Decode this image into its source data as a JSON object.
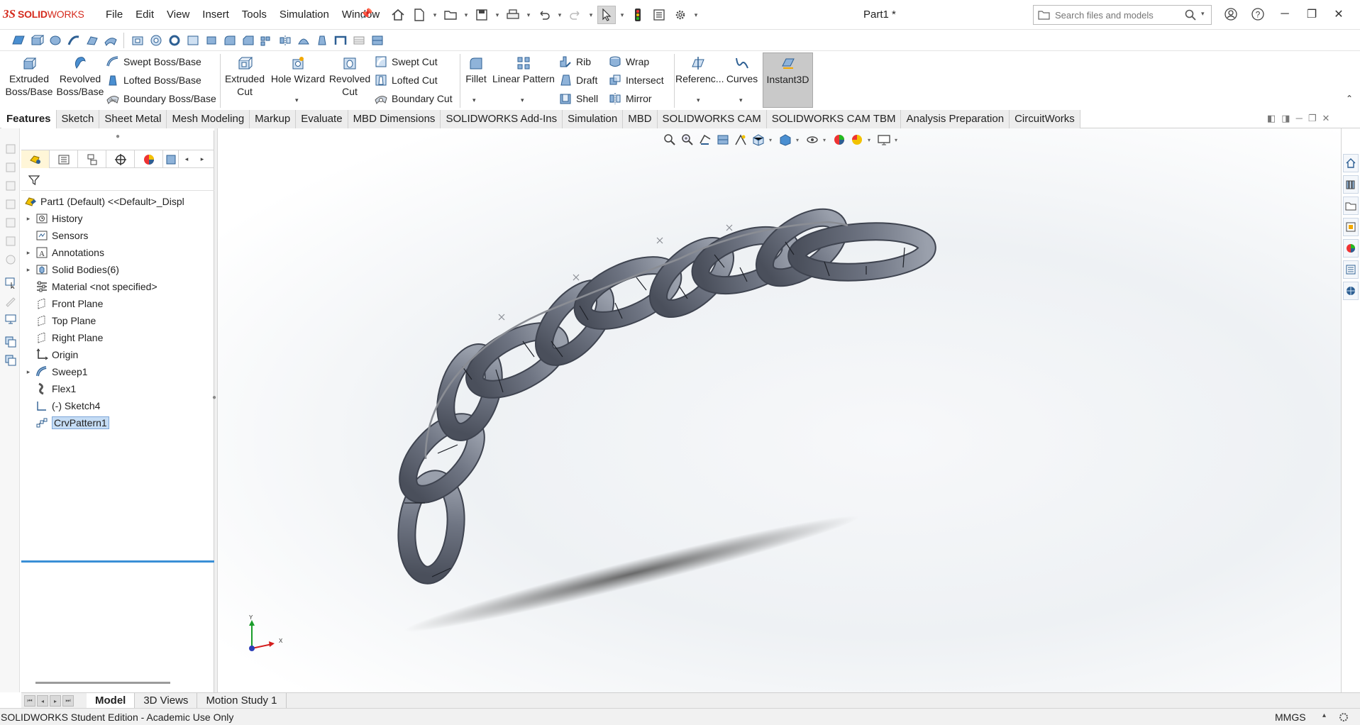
{
  "app": {
    "brand_ds": "3S",
    "brand_name": "SOLID",
    "brand_name2": "WORKS",
    "document_title": "Part1 *"
  },
  "menu": [
    "File",
    "Edit",
    "View",
    "Insert",
    "Tools",
    "Simulation",
    "Window"
  ],
  "search": {
    "placeholder": "Search files and models"
  },
  "command_manager": {
    "extruded_boss": "Extruded Boss/Base",
    "revolved_boss": "Revolved Boss/Base",
    "swept_boss": "Swept Boss/Base",
    "lofted_boss": "Lofted Boss/Base",
    "boundary_boss": "Boundary Boss/Base",
    "extruded_cut": "Extruded Cut",
    "hole_wizard": "Hole Wizard",
    "revolved_cut": "Revolved Cut",
    "swept_cut": "Swept Cut",
    "lofted_cut": "Lofted Cut",
    "boundary_cut": "Boundary Cut",
    "fillet": "Fillet",
    "linear_pattern": "Linear Pattern",
    "rib": "Rib",
    "draft": "Draft",
    "shell": "Shell",
    "wrap": "Wrap",
    "intersect": "Intersect",
    "mirror": "Mirror",
    "reference": "Referenc...",
    "curves": "Curves",
    "instant3d": "Instant3D"
  },
  "tabs": [
    "Features",
    "Sketch",
    "Sheet Metal",
    "Mesh Modeling",
    "Markup",
    "Evaluate",
    "MBD Dimensions",
    "SOLIDWORKS Add-Ins",
    "Simulation",
    "MBD",
    "SOLIDWORKS CAM",
    "SOLIDWORKS CAM TBM",
    "Analysis Preparation",
    "CircuitWorks"
  ],
  "tree": [
    {
      "label": "Part1 (Default) <<Default>_Displ",
      "expand": "",
      "icon": "part-icon"
    },
    {
      "label": "History",
      "expand": "▸",
      "icon": "history-icon"
    },
    {
      "label": "Sensors",
      "expand": "",
      "icon": "sensors-icon"
    },
    {
      "label": "Annotations",
      "expand": "▸",
      "icon": "annotations-icon"
    },
    {
      "label": "Solid Bodies(6)",
      "expand": "▸",
      "icon": "solid-bodies-icon"
    },
    {
      "label": "Material <not specified>",
      "expand": "",
      "icon": "material-icon"
    },
    {
      "label": "Front Plane",
      "expand": "",
      "icon": "plane-icon"
    },
    {
      "label": "Top Plane",
      "expand": "",
      "icon": "plane-icon"
    },
    {
      "label": "Right Plane",
      "expand": "",
      "icon": "plane-icon"
    },
    {
      "label": "Origin",
      "expand": "",
      "icon": "origin-icon"
    },
    {
      "label": "Sweep1",
      "expand": "▸",
      "icon": "sweep-icon"
    },
    {
      "label": "Flex1",
      "expand": "",
      "icon": "flex-icon"
    },
    {
      "label": "(-) Sketch4",
      "expand": "",
      "icon": "sketch-icon"
    },
    {
      "label": "CrvPattern1",
      "expand": "",
      "icon": "curve-pattern-icon",
      "selected": true
    }
  ],
  "bottom_tabs": [
    "Model",
    "3D Views",
    "Motion Study 1"
  ],
  "status": {
    "edition": "SOLIDWORKS Student Edition - Academic Use Only",
    "units": "MMGS"
  },
  "triad": {
    "y": "Y",
    "x": "X"
  },
  "colors": {
    "brand_red": "#d52b1e",
    "chain_gray": "#6d7280",
    "selection_blue": "#3a8fd6"
  }
}
